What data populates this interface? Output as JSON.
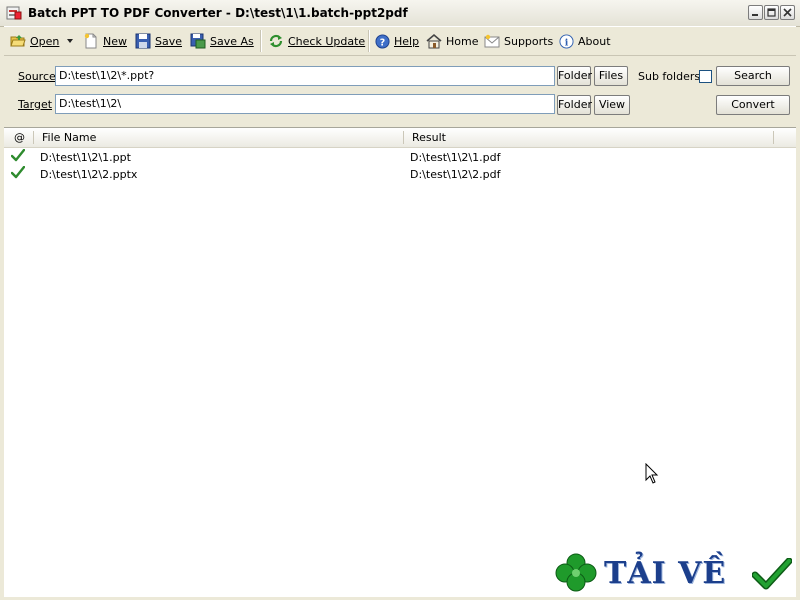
{
  "window": {
    "title": "Batch PPT TO PDF Converter - D:\\test\\1\\1.batch-ppt2pdf"
  },
  "toolbar": {
    "open_label": "Open",
    "new_label": "New",
    "save_label": "Save",
    "save_as_label": "Save As",
    "check_update_label": "Check Update",
    "help_label": "Help",
    "home_label": "Home",
    "supports_label": "Supports",
    "about_label": "About"
  },
  "source": {
    "label": "Source",
    "value": "D:\\test\\1\\2\\*.ppt?",
    "folder_button": "Folder",
    "files_button": "Files",
    "subfolders_label": "Sub folders",
    "subfolders_checked": false,
    "search_button": "Search"
  },
  "target": {
    "label": "Target",
    "value": "D:\\test\\1\\2\\",
    "folder_button": "Folder",
    "view_button": "View",
    "convert_button": "Convert"
  },
  "list": {
    "columns": [
      "@",
      "File Name",
      "Result"
    ],
    "rows": [
      {
        "status": "success",
        "file": "D:\\test\\1\\2\\1.ppt",
        "result": "D:\\test\\1\\2\\1.pdf"
      },
      {
        "status": "success",
        "file": "D:\\test\\1\\2\\2.pptx",
        "result": "D:\\test\\1\\2\\2.pdf"
      }
    ]
  },
  "watermark": {
    "text": "TẢI VỀ"
  },
  "colors": {
    "success_check": "#2e8b2e",
    "watermark_text": "#1c3f8c",
    "clover": "#1f9a2b"
  }
}
